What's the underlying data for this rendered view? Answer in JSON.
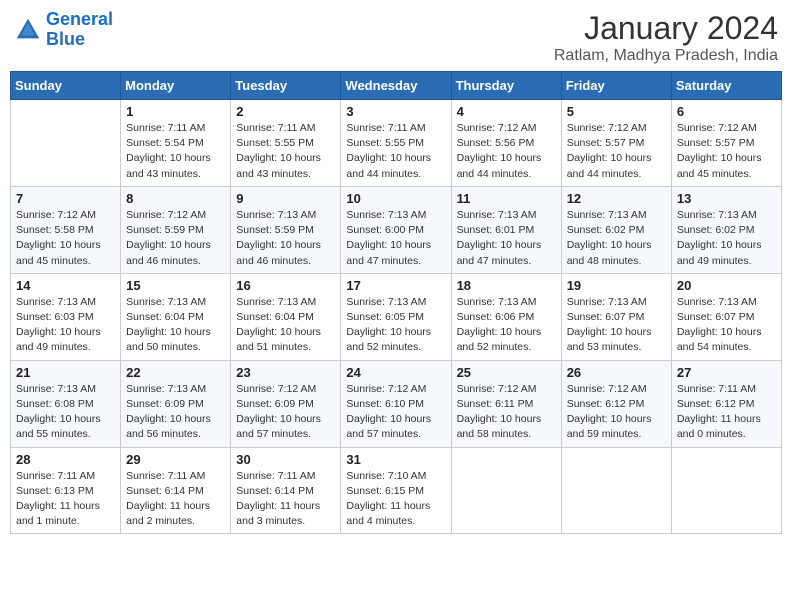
{
  "header": {
    "logo_line1": "General",
    "logo_line2": "Blue",
    "title": "January 2024",
    "subtitle": "Ratlam, Madhya Pradesh, India"
  },
  "days_of_week": [
    "Sunday",
    "Monday",
    "Tuesday",
    "Wednesday",
    "Thursday",
    "Friday",
    "Saturday"
  ],
  "weeks": [
    [
      {
        "num": "",
        "detail": ""
      },
      {
        "num": "1",
        "detail": "Sunrise: 7:11 AM\nSunset: 5:54 PM\nDaylight: 10 hours\nand 43 minutes."
      },
      {
        "num": "2",
        "detail": "Sunrise: 7:11 AM\nSunset: 5:55 PM\nDaylight: 10 hours\nand 43 minutes."
      },
      {
        "num": "3",
        "detail": "Sunrise: 7:11 AM\nSunset: 5:55 PM\nDaylight: 10 hours\nand 44 minutes."
      },
      {
        "num": "4",
        "detail": "Sunrise: 7:12 AM\nSunset: 5:56 PM\nDaylight: 10 hours\nand 44 minutes."
      },
      {
        "num": "5",
        "detail": "Sunrise: 7:12 AM\nSunset: 5:57 PM\nDaylight: 10 hours\nand 44 minutes."
      },
      {
        "num": "6",
        "detail": "Sunrise: 7:12 AM\nSunset: 5:57 PM\nDaylight: 10 hours\nand 45 minutes."
      }
    ],
    [
      {
        "num": "7",
        "detail": "Sunrise: 7:12 AM\nSunset: 5:58 PM\nDaylight: 10 hours\nand 45 minutes."
      },
      {
        "num": "8",
        "detail": "Sunrise: 7:12 AM\nSunset: 5:59 PM\nDaylight: 10 hours\nand 46 minutes."
      },
      {
        "num": "9",
        "detail": "Sunrise: 7:13 AM\nSunset: 5:59 PM\nDaylight: 10 hours\nand 46 minutes."
      },
      {
        "num": "10",
        "detail": "Sunrise: 7:13 AM\nSunset: 6:00 PM\nDaylight: 10 hours\nand 47 minutes."
      },
      {
        "num": "11",
        "detail": "Sunrise: 7:13 AM\nSunset: 6:01 PM\nDaylight: 10 hours\nand 47 minutes."
      },
      {
        "num": "12",
        "detail": "Sunrise: 7:13 AM\nSunset: 6:02 PM\nDaylight: 10 hours\nand 48 minutes."
      },
      {
        "num": "13",
        "detail": "Sunrise: 7:13 AM\nSunset: 6:02 PM\nDaylight: 10 hours\nand 49 minutes."
      }
    ],
    [
      {
        "num": "14",
        "detail": "Sunrise: 7:13 AM\nSunset: 6:03 PM\nDaylight: 10 hours\nand 49 minutes."
      },
      {
        "num": "15",
        "detail": "Sunrise: 7:13 AM\nSunset: 6:04 PM\nDaylight: 10 hours\nand 50 minutes."
      },
      {
        "num": "16",
        "detail": "Sunrise: 7:13 AM\nSunset: 6:04 PM\nDaylight: 10 hours\nand 51 minutes."
      },
      {
        "num": "17",
        "detail": "Sunrise: 7:13 AM\nSunset: 6:05 PM\nDaylight: 10 hours\nand 52 minutes."
      },
      {
        "num": "18",
        "detail": "Sunrise: 7:13 AM\nSunset: 6:06 PM\nDaylight: 10 hours\nand 52 minutes."
      },
      {
        "num": "19",
        "detail": "Sunrise: 7:13 AM\nSunset: 6:07 PM\nDaylight: 10 hours\nand 53 minutes."
      },
      {
        "num": "20",
        "detail": "Sunrise: 7:13 AM\nSunset: 6:07 PM\nDaylight: 10 hours\nand 54 minutes."
      }
    ],
    [
      {
        "num": "21",
        "detail": "Sunrise: 7:13 AM\nSunset: 6:08 PM\nDaylight: 10 hours\nand 55 minutes."
      },
      {
        "num": "22",
        "detail": "Sunrise: 7:13 AM\nSunset: 6:09 PM\nDaylight: 10 hours\nand 56 minutes."
      },
      {
        "num": "23",
        "detail": "Sunrise: 7:12 AM\nSunset: 6:09 PM\nDaylight: 10 hours\nand 57 minutes."
      },
      {
        "num": "24",
        "detail": "Sunrise: 7:12 AM\nSunset: 6:10 PM\nDaylight: 10 hours\nand 57 minutes."
      },
      {
        "num": "25",
        "detail": "Sunrise: 7:12 AM\nSunset: 6:11 PM\nDaylight: 10 hours\nand 58 minutes."
      },
      {
        "num": "26",
        "detail": "Sunrise: 7:12 AM\nSunset: 6:12 PM\nDaylight: 10 hours\nand 59 minutes."
      },
      {
        "num": "27",
        "detail": "Sunrise: 7:11 AM\nSunset: 6:12 PM\nDaylight: 11 hours\nand 0 minutes."
      }
    ],
    [
      {
        "num": "28",
        "detail": "Sunrise: 7:11 AM\nSunset: 6:13 PM\nDaylight: 11 hours\nand 1 minute."
      },
      {
        "num": "29",
        "detail": "Sunrise: 7:11 AM\nSunset: 6:14 PM\nDaylight: 11 hours\nand 2 minutes."
      },
      {
        "num": "30",
        "detail": "Sunrise: 7:11 AM\nSunset: 6:14 PM\nDaylight: 11 hours\nand 3 minutes."
      },
      {
        "num": "31",
        "detail": "Sunrise: 7:10 AM\nSunset: 6:15 PM\nDaylight: 11 hours\nand 4 minutes."
      },
      {
        "num": "",
        "detail": ""
      },
      {
        "num": "",
        "detail": ""
      },
      {
        "num": "",
        "detail": ""
      }
    ]
  ]
}
